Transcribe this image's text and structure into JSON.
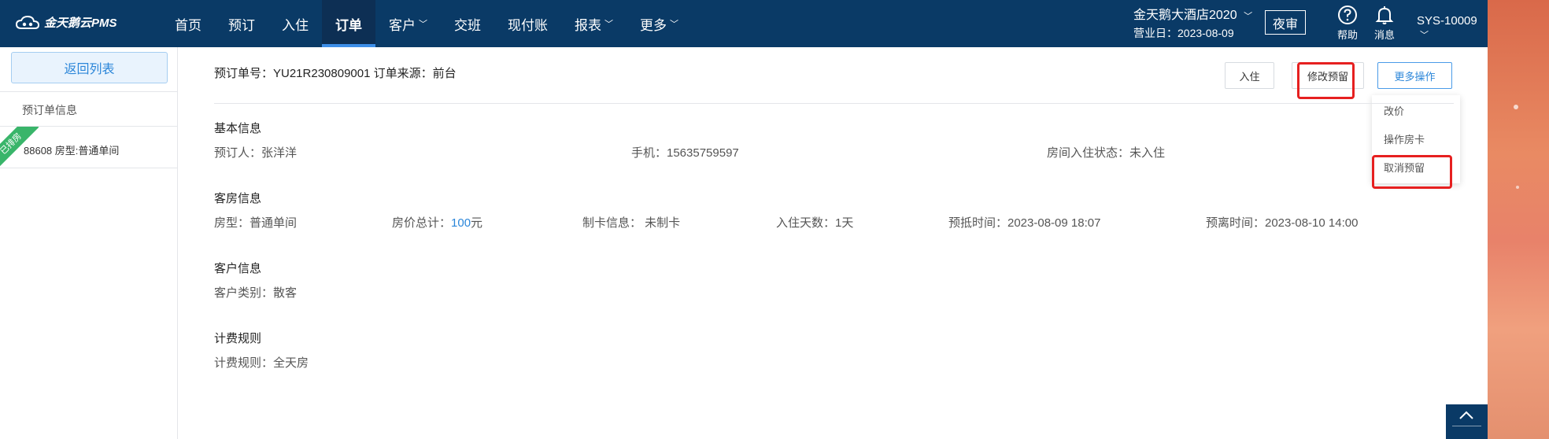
{
  "topbar": {
    "logo_text": "金天鹅云PMS",
    "nav": [
      {
        "label": "首页",
        "chevron": false
      },
      {
        "label": "预订",
        "chevron": false
      },
      {
        "label": "入住",
        "chevron": false
      },
      {
        "label": "订单",
        "chevron": false,
        "active": true
      },
      {
        "label": "客户",
        "chevron": true
      },
      {
        "label": "交班",
        "chevron": false
      },
      {
        "label": "现付账",
        "chevron": false
      },
      {
        "label": "报表",
        "chevron": true
      },
      {
        "label": "更多",
        "chevron": true
      }
    ],
    "hotel_name": "金天鹅大酒店2020",
    "business_date": "营业日：2023-08-09",
    "night_audit": "夜审",
    "help": "帮助",
    "messages": "消息",
    "user": "SYS-10009"
  },
  "sidebar": {
    "back_label": "返回列表",
    "section_label": "预订单信息",
    "room_badge": "已排房",
    "room_text": "88608  房型:普通单间"
  },
  "order": {
    "header": "预订单号：YU21R230809001   订单来源：前台",
    "buttons": {
      "checkin": "入住",
      "modify": "修改预留",
      "more": "更多操作"
    },
    "dropdown": [
      "改价",
      "操作房卡",
      "取消预留"
    ]
  },
  "basic": {
    "title": "基本信息",
    "booker": "预订人：张洋洋",
    "phone": "手机：15635759597",
    "status": "房间入住状态：未入住"
  },
  "room": {
    "title": "客房信息",
    "type": "房型：普通单间",
    "price_label": "房价总计：",
    "price_value": "100",
    "price_unit": "元",
    "card": "制卡信息：  未制卡",
    "days": "入住天数：1天",
    "arrive": "预抵时间：2023-08-09 18:07",
    "depart": "预离时间：2023-08-10 14:00"
  },
  "customer": {
    "title": "客户信息",
    "type": "客户类别：散客"
  },
  "billing": {
    "title": "计费规则",
    "rule": "计费规则：全天房"
  },
  "colors": {
    "nav_bg": "#0a3a66",
    "accent": "#2b86d9",
    "highlight": "#e62020",
    "badge": "#39b56a"
  }
}
